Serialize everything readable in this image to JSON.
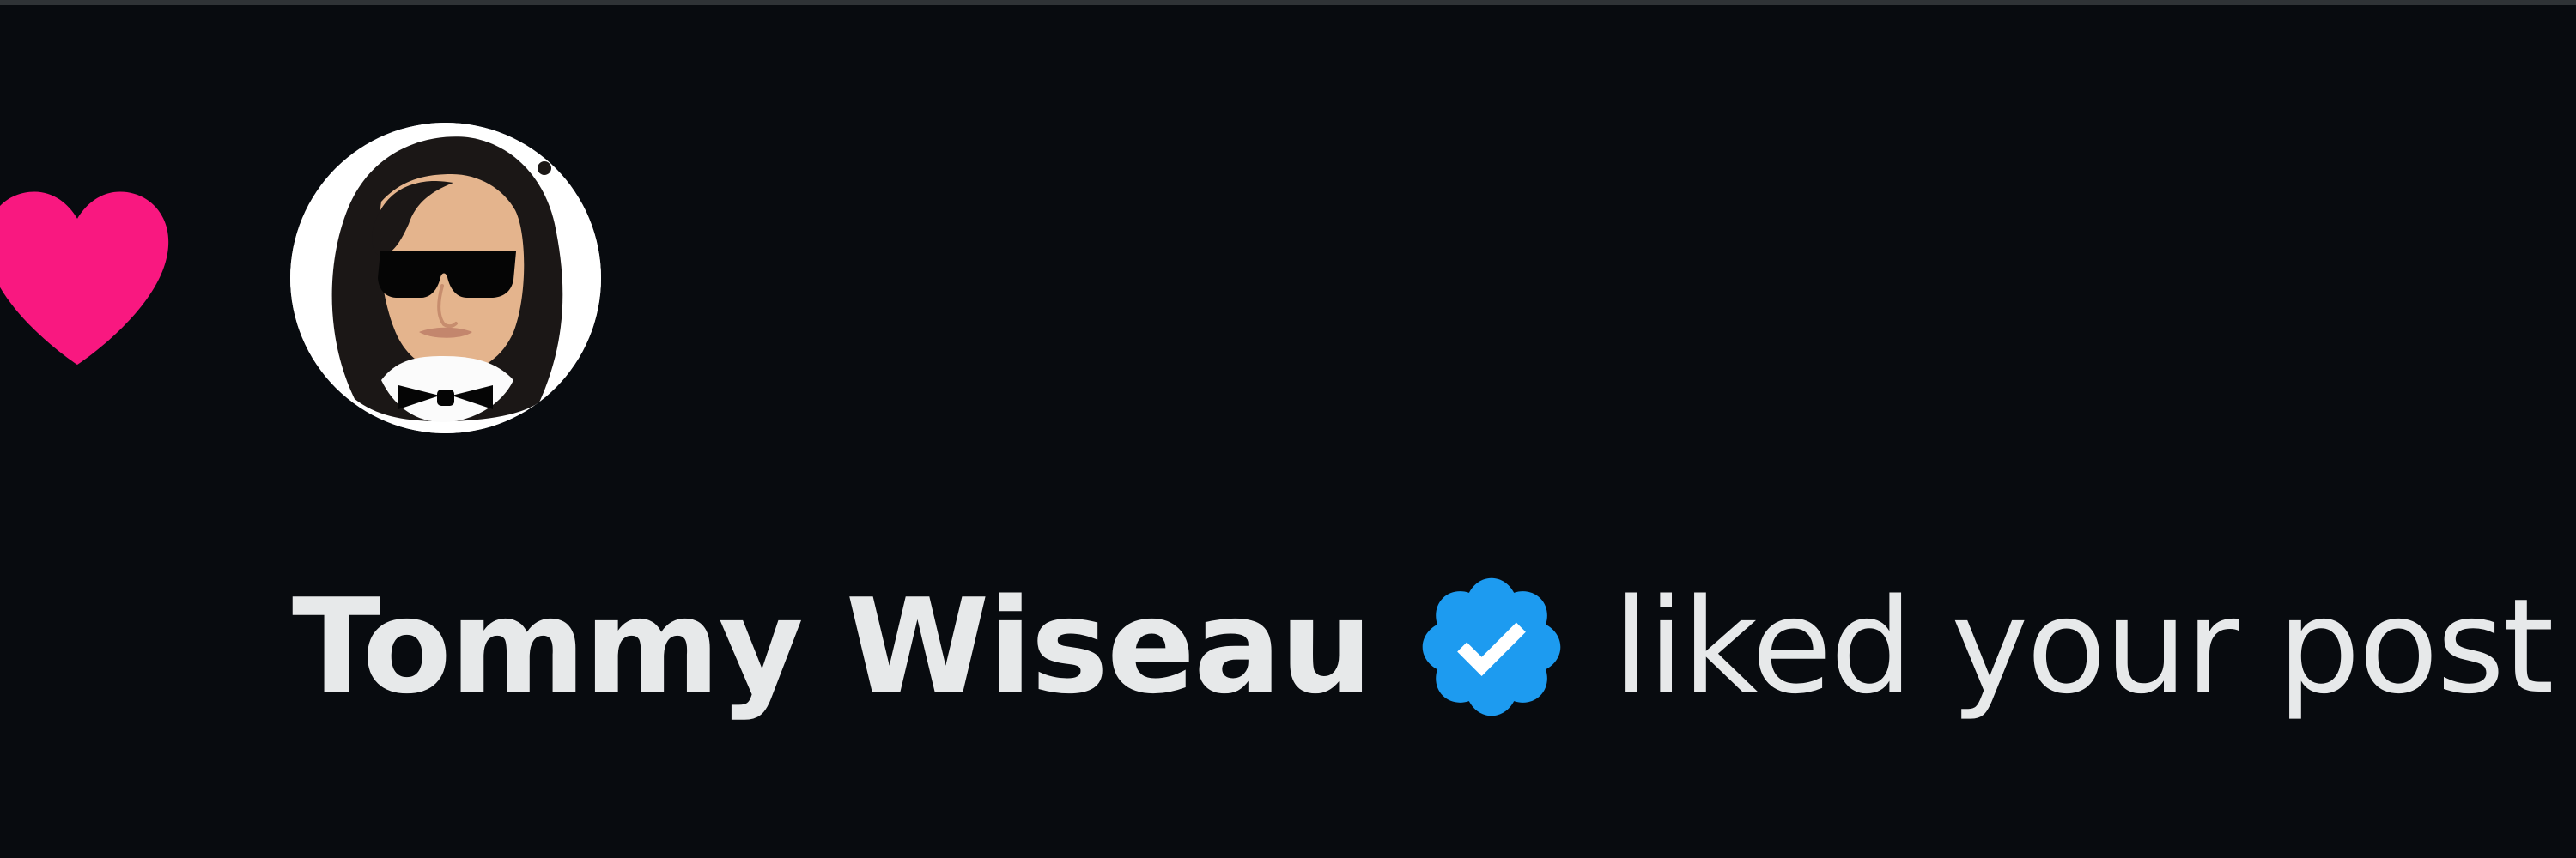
{
  "notification": {
    "type_icon": "heart-icon",
    "user": {
      "display_name": "Tommy Wiseau",
      "verified": true,
      "avatar_icon": "profile-avatar"
    },
    "action_text": "liked your post"
  },
  "colors": {
    "background": "#080b0f",
    "heart": "#f91880",
    "verified": "#1d9bf0",
    "text": "#e7e9ea"
  }
}
